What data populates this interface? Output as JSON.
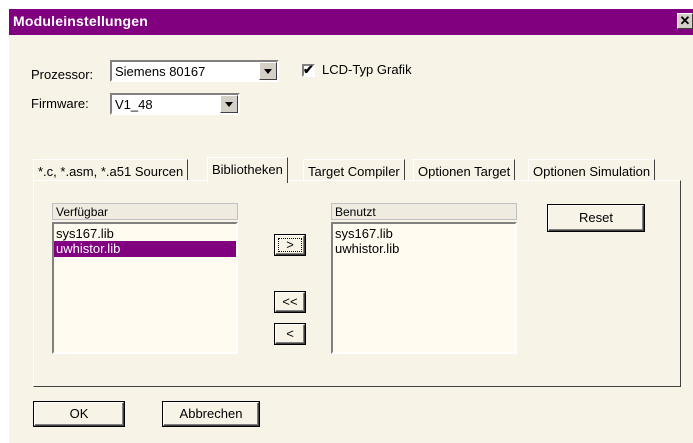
{
  "window": {
    "title": "Moduleinstellungen",
    "close_label": "✕"
  },
  "form": {
    "processor_label": "Prozessor:",
    "processor_value": "Siemens 80167",
    "firmware_label": "Firmware:",
    "firmware_value": "V1_48",
    "lcd_label": "LCD-Typ Grafik",
    "lcd_checked": true
  },
  "tabs": [
    {
      "label": "*.c, *.asm, *.a51 Sourcen"
    },
    {
      "label": "Bibliotheken"
    },
    {
      "label": "Target Compiler"
    },
    {
      "label": "Optionen Target"
    },
    {
      "label": "Optionen Simulation"
    }
  ],
  "active_tab": "Bibliotheken",
  "available": {
    "header": "Verfügbar",
    "items": [
      "sys167.lib",
      "uwhistor.lib"
    ],
    "selected": "uwhistor.lib"
  },
  "used": {
    "header": "Benutzt",
    "items": [
      "sys167.lib",
      "uwhistor.lib"
    ]
  },
  "buttons": {
    "add": ">",
    "remove_all": "<<",
    "remove": "<",
    "reset": "Reset",
    "ok": "OK",
    "cancel": "Abbrechen"
  },
  "colors": {
    "titlebar": "#800080",
    "selection": "#800080",
    "dialog_bg": "#f7f3e7"
  }
}
